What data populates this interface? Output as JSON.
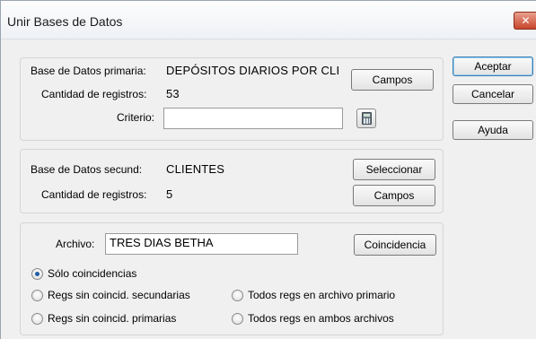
{
  "window": {
    "title": "Unir Bases de Datos",
    "close_glyph": "✕"
  },
  "primary": {
    "db_label": "Base de Datos primaria:",
    "db_value": "DEPÓSITOS DIARIOS POR CLI",
    "count_label": "Cantidad de registros:",
    "count_value": "53",
    "criteria_label": "Criterio:",
    "criteria_value": "",
    "fields_button": "Campos",
    "calculator_icon": "calculator-icon"
  },
  "secondary": {
    "db_label": "Base de Datos secund:",
    "db_value": "CLIENTES",
    "count_label": "Cantidad de registros:",
    "count_value": "5",
    "select_button": "Seleccionar",
    "fields_button": "Campos"
  },
  "output": {
    "file_label": "Archivo:",
    "file_value": "TRES DIAS BETHA",
    "match_button": "Coincidencia",
    "options": [
      {
        "label": "Sólo coincidencias",
        "checked": true
      },
      {
        "label": "Regs sin coincid. secundarias",
        "checked": false
      },
      {
        "label": "Todos regs en archivo primario",
        "checked": false
      },
      {
        "label": "Regs sin coincid. primarias",
        "checked": false
      },
      {
        "label": "Todos regs en ambos archivos",
        "checked": false
      }
    ]
  },
  "actions": {
    "ok": "Aceptar",
    "cancel": "Cancelar",
    "help": "Ayuda"
  },
  "colors": {
    "accent": "#3c7fb1",
    "close": "#c8462c",
    "dialog_bg": "#f0f0f0"
  }
}
